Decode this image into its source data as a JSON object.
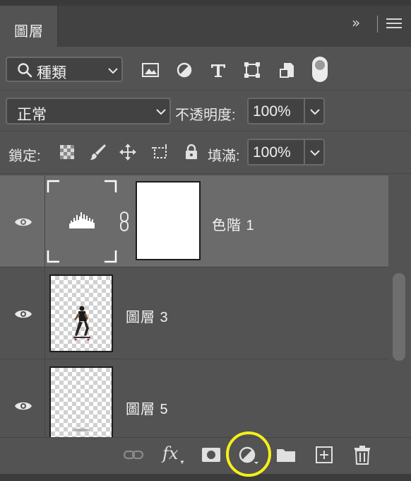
{
  "panel": {
    "tab_label": "圖層",
    "collapse_icon": "double-chevron-right-icon",
    "menu_icon": "hamburger-menu-icon"
  },
  "filter": {
    "kind_label": "種類",
    "icons": [
      "image-filter-icon",
      "adjustment-filter-icon",
      "type-filter-icon",
      "shape-filter-icon",
      "smart-object-filter-icon"
    ],
    "toggle_on": true
  },
  "blend": {
    "mode": "正常",
    "opacity_label": "不透明度:",
    "opacity_value": "100%"
  },
  "lock": {
    "label": "鎖定:",
    "fill_label": "填滿:",
    "fill_value": "100%",
    "icons": [
      "lock-transparent-pixels-icon",
      "lock-image-pixels-icon",
      "lock-position-icon",
      "lock-artboard-icon",
      "lock-all-icon"
    ]
  },
  "layers": [
    {
      "name": "色階 1",
      "type": "adjustment",
      "visible": true,
      "selected": true
    },
    {
      "name": "圖層 3",
      "type": "pixel",
      "visible": true,
      "selected": false
    },
    {
      "name": "圖層 5",
      "type": "pixel",
      "visible": true,
      "selected": false
    }
  ],
  "toolbar": {
    "icons": [
      "link-layers-icon",
      "fx-icon",
      "add-mask-icon",
      "new-adjustment-layer-icon",
      "new-group-icon",
      "new-layer-icon",
      "delete-layer-icon"
    ],
    "fx_text": "fx",
    "highlight_color": "#f5ef1a"
  },
  "colors": {
    "panel_bg": "#535353",
    "selected_row": "#6b6b6b",
    "header_bg": "#424242"
  }
}
